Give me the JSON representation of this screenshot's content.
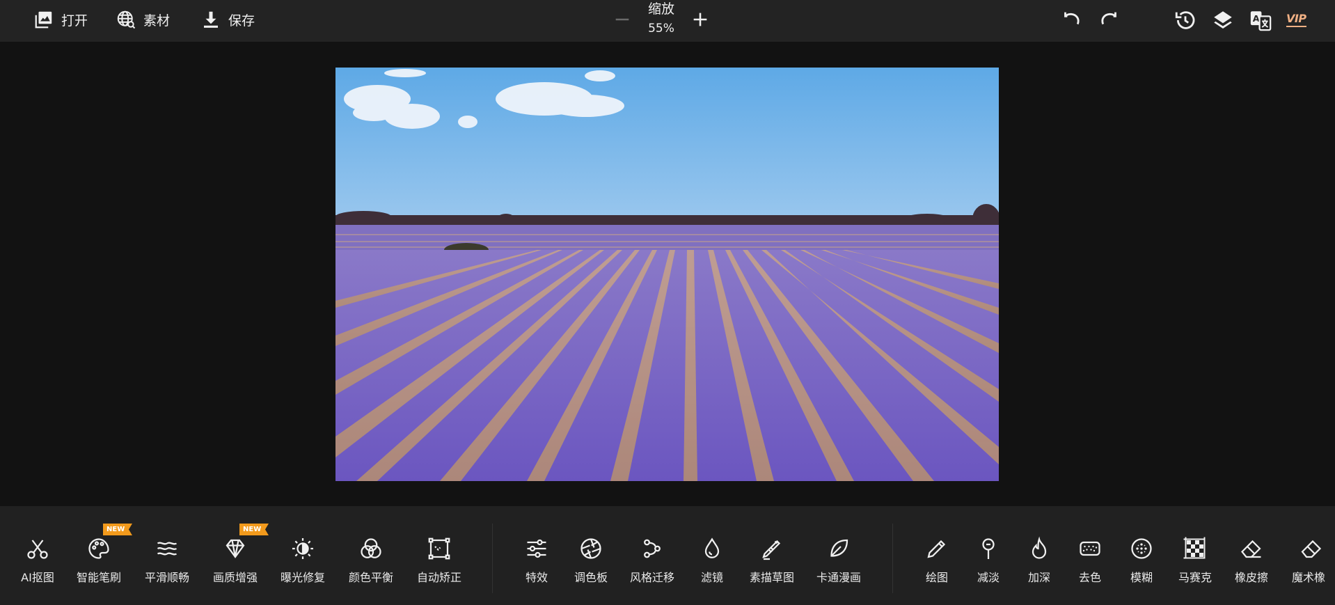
{
  "toolbar": {
    "open_label": "打开",
    "assets_label": "素材",
    "save_label": "保存",
    "zoom_label": "缩放",
    "zoom_value": "55%",
    "vip_label": "VIP"
  },
  "canvas": {
    "description_alt": "Lavender field under blue sky"
  },
  "groups": {
    "ai": [
      {
        "label": "AI抠图",
        "icon": "scissors-icon"
      },
      {
        "label": "智能笔刷",
        "icon": "palette-icon",
        "badge": "NEW"
      },
      {
        "label": "平滑顺畅",
        "icon": "waves-icon"
      },
      {
        "label": "画质增强",
        "icon": "diamond-icon",
        "badge": "NEW"
      },
      {
        "label": "曝光修复",
        "icon": "brightness-icon"
      },
      {
        "label": "颜色平衡",
        "icon": "color-circles-icon"
      },
      {
        "label": "自动矫正",
        "icon": "crop-frame-icon"
      }
    ],
    "style": [
      {
        "label": "特效",
        "icon": "sliders-icon"
      },
      {
        "label": "调色板",
        "icon": "aperture-icon"
      },
      {
        "label": "风格迁移",
        "icon": "style-transfer-icon"
      },
      {
        "label": "滤镜",
        "icon": "drop-icon"
      },
      {
        "label": "素描草图",
        "icon": "sketch-pen-icon"
      },
      {
        "label": "卡通漫画",
        "icon": "leaf-icon"
      }
    ],
    "draw": [
      {
        "label": "绘图",
        "icon": "pencil-icon"
      },
      {
        "label": "减淡",
        "icon": "dodge-icon"
      },
      {
        "label": "加深",
        "icon": "flame-icon"
      },
      {
        "label": "去色",
        "icon": "sponge-icon"
      },
      {
        "label": "模糊",
        "icon": "blur-icon"
      },
      {
        "label": "马赛克",
        "icon": "mosaic-icon"
      },
      {
        "label": "橡皮擦",
        "icon": "eraser-icon"
      },
      {
        "label": "魔术橡",
        "icon": "magic-eraser-icon"
      }
    ]
  },
  "colors": {
    "topbar": "#232323",
    "bottombar": "#212121",
    "background": "#121212",
    "badge": "#f29a1c",
    "vip": "#f0b084"
  }
}
